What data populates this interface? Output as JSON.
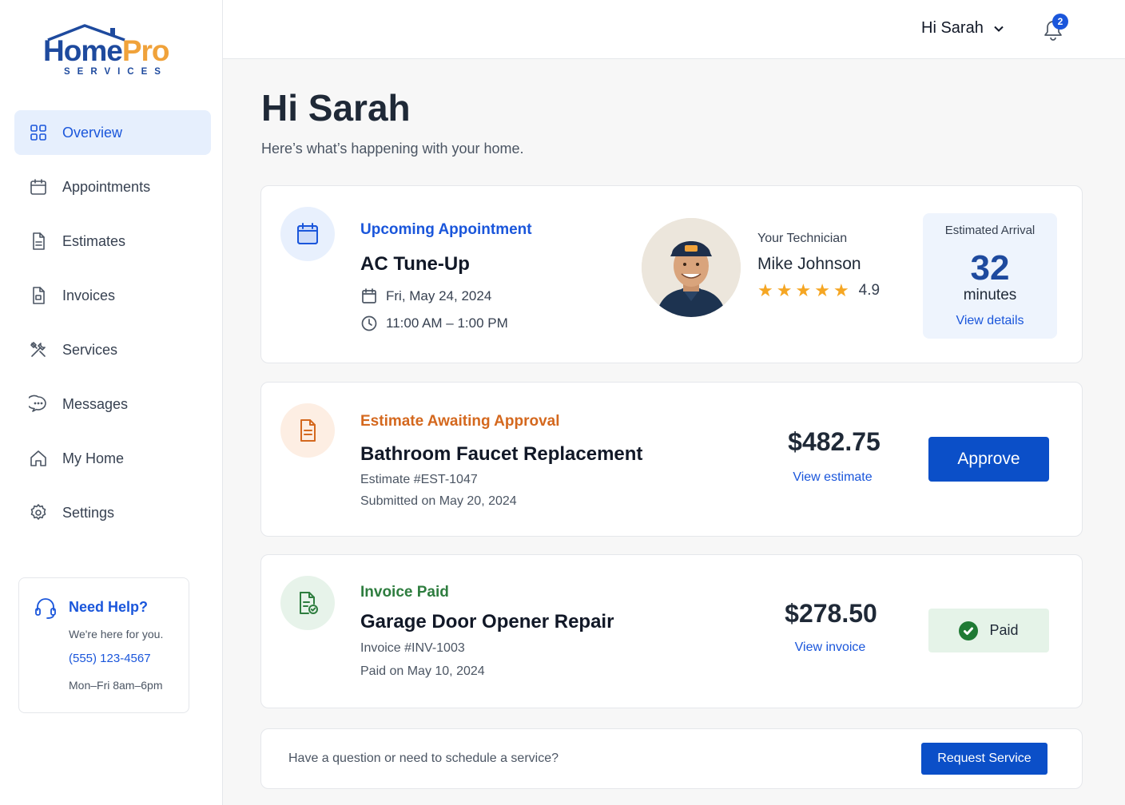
{
  "brand": {
    "name_part1": "Home",
    "name_part2": "Pro",
    "tagline": "SERVICES",
    "colors": {
      "primary": "#1e4a9e",
      "accent": "#f0a23a"
    }
  },
  "sidebar": {
    "items": [
      {
        "label": "Overview",
        "icon": "grid-icon",
        "active": true
      },
      {
        "label": "Appointments",
        "icon": "calendar-icon"
      },
      {
        "label": "Estimates",
        "icon": "document-icon"
      },
      {
        "label": "Invoices",
        "icon": "invoice-icon"
      },
      {
        "label": "Services",
        "icon": "tools-icon"
      },
      {
        "label": "Messages",
        "icon": "chat-icon"
      },
      {
        "label": "My Home",
        "icon": "home-icon"
      },
      {
        "label": "Settings",
        "icon": "gear-icon"
      }
    ],
    "help": {
      "title": "Need Help?",
      "subtitle": "We're here for you.",
      "phone": "(555) 123-4567",
      "hours": "Mon–Fri 8am–6pm"
    }
  },
  "header": {
    "user_greeting": "Hi Sarah",
    "notification_count": "2"
  },
  "main": {
    "title": "Hi Sarah",
    "subtitle": "Here’s what’s happening with your home.",
    "appointment": {
      "kicker": "Upcoming Appointment",
      "title": "AC Tune-Up",
      "date": "Fri, May 24, 2024",
      "time": "11:00 AM – 1:00 PM",
      "tech_label": "Your Technician",
      "tech_name": "Mike Johnson",
      "rating": "4.9",
      "stars": 5,
      "eta_label": "Estimated Arrival",
      "eta_value": "32",
      "eta_unit": "minutes",
      "eta_link": "View details"
    },
    "estimate": {
      "kicker": "Estimate Awaiting Approval",
      "title": "Bathroom Faucet Replacement",
      "number": "Estimate #EST-1047",
      "submitted": "Submitted on May 20, 2024",
      "amount": "$482.75",
      "link": "View estimate",
      "button": "Approve"
    },
    "invoice": {
      "kicker": "Invoice Paid",
      "title": "Garage Door Opener Repair",
      "number": "Invoice #INV-1003",
      "paid_on": "Paid on May 10, 2024",
      "amount": "$278.50",
      "link": "View invoice",
      "status": "Paid"
    },
    "cta": {
      "text": "Have a question or need to schedule a service?",
      "button": "Request Service"
    }
  }
}
